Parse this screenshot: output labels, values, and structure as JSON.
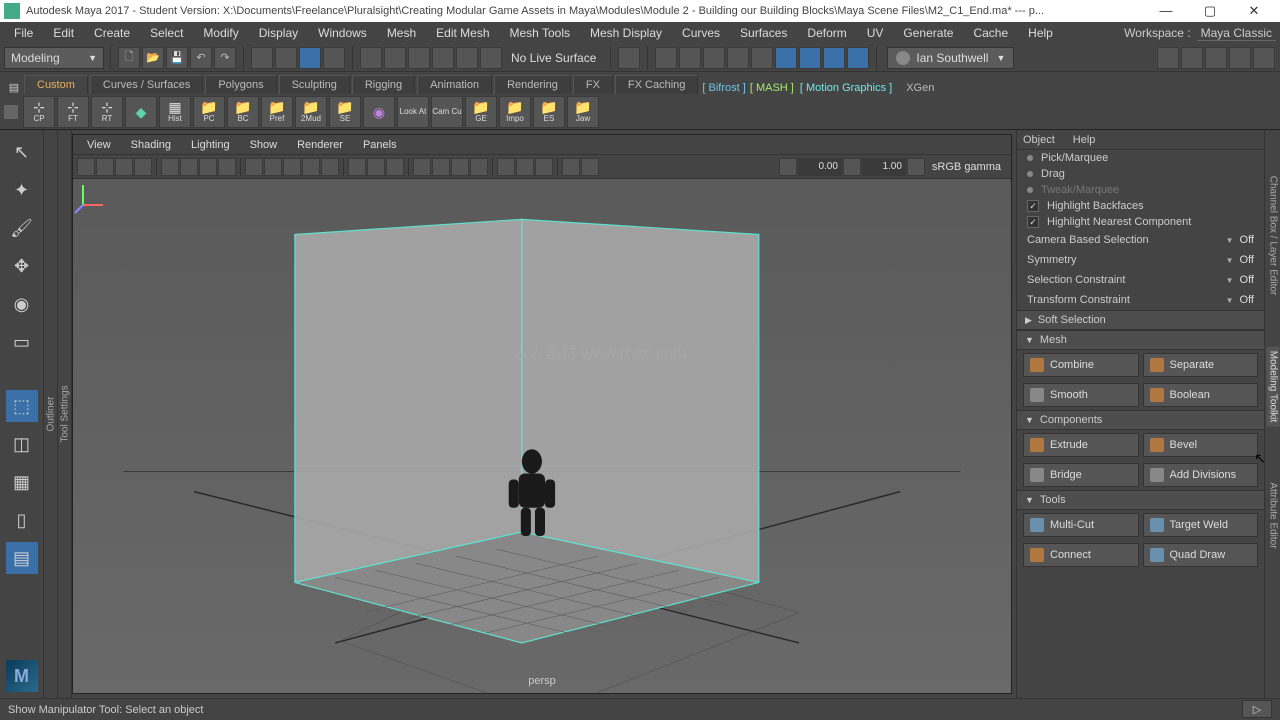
{
  "title_bar": {
    "app": "Autodesk Maya 2017 - Student Version: ",
    "path": "X:\\Documents\\Freelance\\Pluralsight\\Creating Modular Game Assets in Maya\\Modules\\Module 2 - Building our Building Blocks\\Maya Scene Files\\M2_C1_End.ma*  ---  p...",
    "truncated_ext": "p..."
  },
  "main_menu": [
    "File",
    "Edit",
    "Create",
    "Select",
    "Modify",
    "Display",
    "Windows",
    "Mesh",
    "Edit Mesh",
    "Mesh Tools",
    "Mesh Display",
    "Curves",
    "Surfaces",
    "Deform",
    "UV",
    "Generate",
    "Cache",
    "Help"
  ],
  "workspace": {
    "label": "Workspace :",
    "name": "Maya Classic"
  },
  "mode_selector": "Modeling",
  "status_bar": {
    "live_surface": "No Live Surface",
    "account": "Ian Southwell"
  },
  "shelf_tabs": [
    "Custom",
    "Curves / Surfaces",
    "Polygons",
    "Sculpting",
    "Rigging",
    "Animation",
    "Rendering",
    "FX",
    "FX Caching"
  ],
  "shelf_extra": {
    "bifrost": "Bifrost",
    "mash": "MASH",
    "motion": "Motion Graphics",
    "xgen": "XGen"
  },
  "shelf_active": "Custom",
  "shelf_buttons": [
    "CP",
    "FT",
    "RT",
    "",
    "Hist",
    "PC",
    "BC",
    "Pref",
    "2Mud",
    "SE",
    "",
    "Look At",
    "Cam Cu",
    "GE",
    "Impo",
    "ES",
    "Jaw"
  ],
  "viewport_menu": [
    "View",
    "Shading",
    "Lighting",
    "Show",
    "Renderer",
    "Panels"
  ],
  "viewport_vals": {
    "near": "0.00",
    "far": "1.00",
    "gamma": "sRGB gamma",
    "camera": "persp"
  },
  "left_vlabels": {
    "outliner": "Outliner",
    "toolsettings": "Tool Settings"
  },
  "right_panel": {
    "menus": [
      "Object",
      "Help"
    ],
    "picks": [
      {
        "label": "Pick/Marquee",
        "disabled": false
      },
      {
        "label": "Drag",
        "disabled": false
      },
      {
        "label": "Tweak/Marquee",
        "disabled": true
      }
    ],
    "checks": [
      "Highlight Backfaces",
      "Highlight Nearest Component"
    ],
    "rows": [
      {
        "label": "Camera Based Selection",
        "value": "Off"
      },
      {
        "label": "Symmetry",
        "value": "Off"
      },
      {
        "label": "Selection Constraint",
        "value": "Off"
      },
      {
        "label": "Transform Constraint",
        "value": "Off"
      }
    ],
    "sections": {
      "soft": "Soft Selection",
      "mesh": "Mesh",
      "mesh_btns": [
        [
          "Combine",
          "Separate"
        ],
        [
          "Smooth",
          "Boolean"
        ]
      ],
      "components": "Components",
      "comp_btns": [
        [
          "Extrude",
          "Bevel"
        ],
        [
          "Bridge",
          "Add Divisions"
        ]
      ],
      "tools": "Tools",
      "tool_btns": [
        [
          "Multi-Cut",
          "Target Weld"
        ],
        [
          "Connect",
          "Quad Draw"
        ]
      ]
    }
  },
  "right_vtabs": [
    "Channel Box / Layer Editor",
    "Modeling Toolkit",
    "Attribute Editor"
  ],
  "right_vtab_active": "Modeling Toolkit",
  "status_line": "Show Manipulator Tool: Select an object",
  "watermark": "人人素材  www.rr-sc.com"
}
